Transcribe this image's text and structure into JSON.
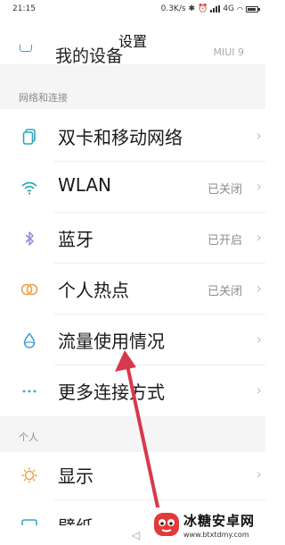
{
  "status": {
    "time": "21:15",
    "speed": "0.3K/s",
    "network": "4G"
  },
  "header": {
    "title": "设置"
  },
  "partial_row": {
    "label": "我的设备",
    "value": "MIUI 9"
  },
  "sections": [
    {
      "header": "网络和连接",
      "items": [
        {
          "label": "双卡和移动网络",
          "value": "",
          "icon": "sim-card-icon"
        },
        {
          "label": "WLAN",
          "value": "已关闭",
          "icon": "wifi-icon"
        },
        {
          "label": "蓝牙",
          "value": "已开启",
          "icon": "bluetooth-icon"
        },
        {
          "label": "个人热点",
          "value": "已关闭",
          "icon": "hotspot-icon"
        },
        {
          "label": "流量使用情况",
          "value": "",
          "icon": "data-usage-icon"
        },
        {
          "label": "更多连接方式",
          "value": "",
          "icon": "more-dots-icon"
        }
      ]
    },
    {
      "header": "个人",
      "items": [
        {
          "label": "显示",
          "value": "",
          "icon": "sun-icon"
        },
        {
          "label": "壁纸",
          "value": "",
          "icon": "wallpaper-icon"
        }
      ]
    }
  ],
  "watermark": {
    "title": "冰糖安卓网",
    "url": "www.btxtdmy.com"
  },
  "colors": {
    "icon_blue": "#3d9cd6",
    "icon_teal": "#2ea7b8",
    "icon_bluetooth": "#8a8ed6",
    "icon_orange": "#f0a045",
    "arrow_red": "#d8394a"
  }
}
